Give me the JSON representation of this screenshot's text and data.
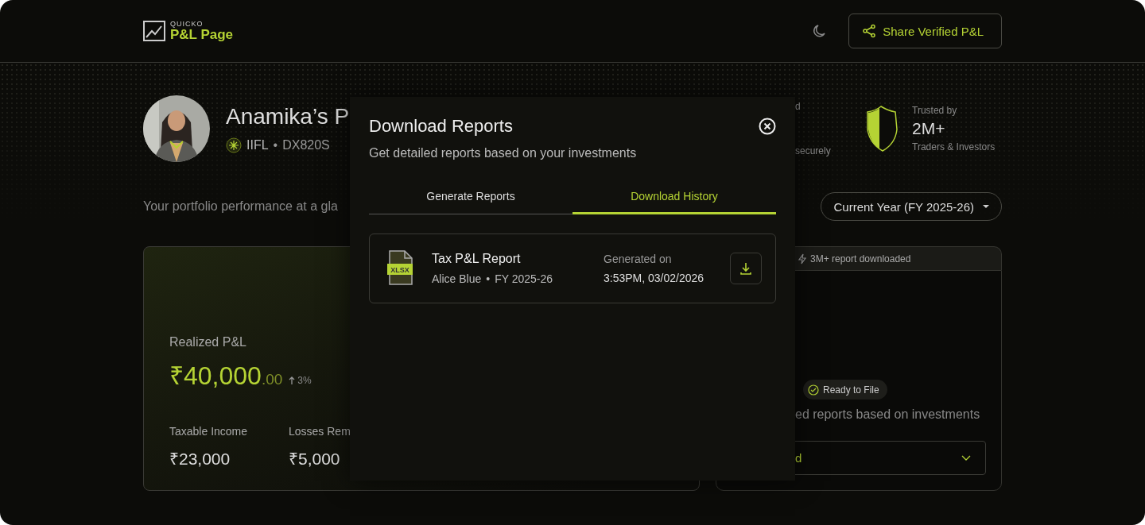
{
  "header": {
    "logo": {
      "brand": "QUICKO",
      "product": "P&L Page"
    },
    "share_button": "Share Verified P&L"
  },
  "profile": {
    "name": "Anamika’s P",
    "broker": "IIFL",
    "separator": "•",
    "client_id": "DX820S"
  },
  "badges": {
    "secure": {
      "line_1": "d",
      "line_2": "securely"
    },
    "trusted": {
      "label": "Trusted by",
      "value": "2M+",
      "caption": "Traders & Investors"
    }
  },
  "tagline": "Your portfolio performance at a gla",
  "period_select": "Current Year (FY 2025-26)",
  "pnl_card": {
    "label": "Realized P&L",
    "amount": "₹40,000",
    "decimals": ".00",
    "change": "3%",
    "stats": [
      {
        "label": "Taxable Income",
        "value": "₹23,000"
      },
      {
        "label": "Losses Rem",
        "value": "₹5,000"
      }
    ]
  },
  "reports_card": {
    "banner": "3M+ report downloaded",
    "status": "Ready to File",
    "description": "ed reports based on investments",
    "select_value": "d"
  },
  "modal": {
    "title": "Download Reports",
    "subtitle": "Get detailed reports based on your investments",
    "tabs": [
      {
        "label": "Generate Reports",
        "selected": false
      },
      {
        "label": "Download History",
        "selected": true
      }
    ],
    "reports": [
      {
        "name": "Tax P&L Report",
        "file_type": "XLSX",
        "broker": "Alice Blue",
        "separator": "•",
        "period": "FY 2025-26",
        "generated_label": "Generated on",
        "generated_at": "3:53PM, 03/02/2026"
      }
    ]
  }
}
